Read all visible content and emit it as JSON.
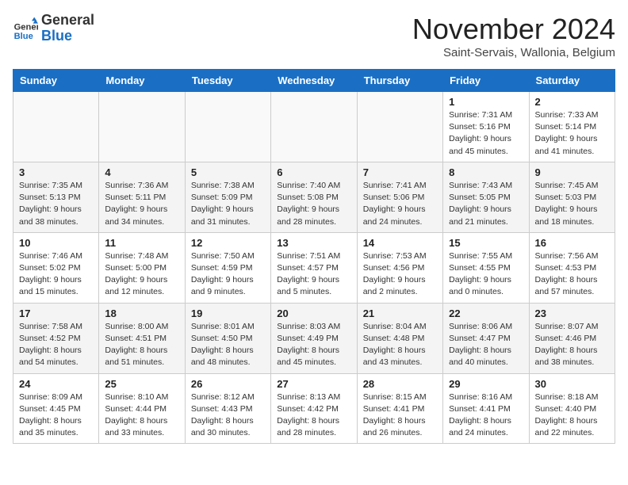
{
  "logo": {
    "line1": "General",
    "line2": "Blue"
  },
  "title": "November 2024",
  "location": "Saint-Servais, Wallonia, Belgium",
  "weekdays": [
    "Sunday",
    "Monday",
    "Tuesday",
    "Wednesday",
    "Thursday",
    "Friday",
    "Saturday"
  ],
  "weeks": [
    [
      {
        "day": "",
        "info": ""
      },
      {
        "day": "",
        "info": ""
      },
      {
        "day": "",
        "info": ""
      },
      {
        "day": "",
        "info": ""
      },
      {
        "day": "",
        "info": ""
      },
      {
        "day": "1",
        "info": "Sunrise: 7:31 AM\nSunset: 5:16 PM\nDaylight: 9 hours\nand 45 minutes."
      },
      {
        "day": "2",
        "info": "Sunrise: 7:33 AM\nSunset: 5:14 PM\nDaylight: 9 hours\nand 41 minutes."
      }
    ],
    [
      {
        "day": "3",
        "info": "Sunrise: 7:35 AM\nSunset: 5:13 PM\nDaylight: 9 hours\nand 38 minutes."
      },
      {
        "day": "4",
        "info": "Sunrise: 7:36 AM\nSunset: 5:11 PM\nDaylight: 9 hours\nand 34 minutes."
      },
      {
        "day": "5",
        "info": "Sunrise: 7:38 AM\nSunset: 5:09 PM\nDaylight: 9 hours\nand 31 minutes."
      },
      {
        "day": "6",
        "info": "Sunrise: 7:40 AM\nSunset: 5:08 PM\nDaylight: 9 hours\nand 28 minutes."
      },
      {
        "day": "7",
        "info": "Sunrise: 7:41 AM\nSunset: 5:06 PM\nDaylight: 9 hours\nand 24 minutes."
      },
      {
        "day": "8",
        "info": "Sunrise: 7:43 AM\nSunset: 5:05 PM\nDaylight: 9 hours\nand 21 minutes."
      },
      {
        "day": "9",
        "info": "Sunrise: 7:45 AM\nSunset: 5:03 PM\nDaylight: 9 hours\nand 18 minutes."
      }
    ],
    [
      {
        "day": "10",
        "info": "Sunrise: 7:46 AM\nSunset: 5:02 PM\nDaylight: 9 hours\nand 15 minutes."
      },
      {
        "day": "11",
        "info": "Sunrise: 7:48 AM\nSunset: 5:00 PM\nDaylight: 9 hours\nand 12 minutes."
      },
      {
        "day": "12",
        "info": "Sunrise: 7:50 AM\nSunset: 4:59 PM\nDaylight: 9 hours\nand 9 minutes."
      },
      {
        "day": "13",
        "info": "Sunrise: 7:51 AM\nSunset: 4:57 PM\nDaylight: 9 hours\nand 5 minutes."
      },
      {
        "day": "14",
        "info": "Sunrise: 7:53 AM\nSunset: 4:56 PM\nDaylight: 9 hours\nand 2 minutes."
      },
      {
        "day": "15",
        "info": "Sunrise: 7:55 AM\nSunset: 4:55 PM\nDaylight: 9 hours\nand 0 minutes."
      },
      {
        "day": "16",
        "info": "Sunrise: 7:56 AM\nSunset: 4:53 PM\nDaylight: 8 hours\nand 57 minutes."
      }
    ],
    [
      {
        "day": "17",
        "info": "Sunrise: 7:58 AM\nSunset: 4:52 PM\nDaylight: 8 hours\nand 54 minutes."
      },
      {
        "day": "18",
        "info": "Sunrise: 8:00 AM\nSunset: 4:51 PM\nDaylight: 8 hours\nand 51 minutes."
      },
      {
        "day": "19",
        "info": "Sunrise: 8:01 AM\nSunset: 4:50 PM\nDaylight: 8 hours\nand 48 minutes."
      },
      {
        "day": "20",
        "info": "Sunrise: 8:03 AM\nSunset: 4:49 PM\nDaylight: 8 hours\nand 45 minutes."
      },
      {
        "day": "21",
        "info": "Sunrise: 8:04 AM\nSunset: 4:48 PM\nDaylight: 8 hours\nand 43 minutes."
      },
      {
        "day": "22",
        "info": "Sunrise: 8:06 AM\nSunset: 4:47 PM\nDaylight: 8 hours\nand 40 minutes."
      },
      {
        "day": "23",
        "info": "Sunrise: 8:07 AM\nSunset: 4:46 PM\nDaylight: 8 hours\nand 38 minutes."
      }
    ],
    [
      {
        "day": "24",
        "info": "Sunrise: 8:09 AM\nSunset: 4:45 PM\nDaylight: 8 hours\nand 35 minutes."
      },
      {
        "day": "25",
        "info": "Sunrise: 8:10 AM\nSunset: 4:44 PM\nDaylight: 8 hours\nand 33 minutes."
      },
      {
        "day": "26",
        "info": "Sunrise: 8:12 AM\nSunset: 4:43 PM\nDaylight: 8 hours\nand 30 minutes."
      },
      {
        "day": "27",
        "info": "Sunrise: 8:13 AM\nSunset: 4:42 PM\nDaylight: 8 hours\nand 28 minutes."
      },
      {
        "day": "28",
        "info": "Sunrise: 8:15 AM\nSunset: 4:41 PM\nDaylight: 8 hours\nand 26 minutes."
      },
      {
        "day": "29",
        "info": "Sunrise: 8:16 AM\nSunset: 4:41 PM\nDaylight: 8 hours\nand 24 minutes."
      },
      {
        "day": "30",
        "info": "Sunrise: 8:18 AM\nSunset: 4:40 PM\nDaylight: 8 hours\nand 22 minutes."
      }
    ]
  ]
}
